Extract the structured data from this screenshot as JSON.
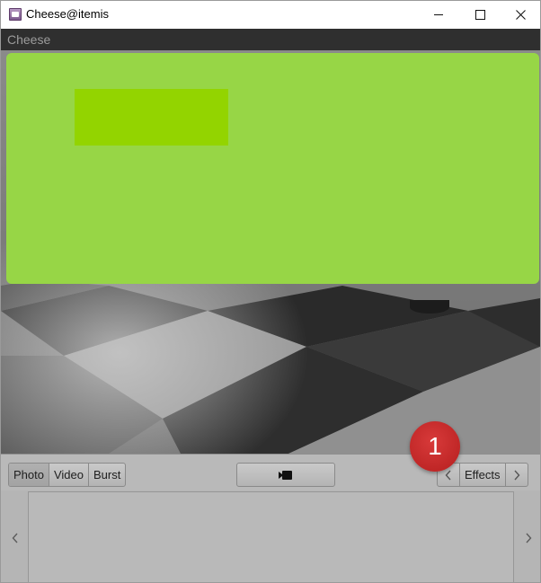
{
  "window": {
    "title": "Cheese@itemis",
    "icon": "cheese-app-icon",
    "controls": [
      "minimize-icon",
      "maximize-icon",
      "close-icon"
    ]
  },
  "header": {
    "title": "Cheese"
  },
  "modes": {
    "items": [
      {
        "label": "Photo",
        "active": true
      },
      {
        "label": "Video",
        "active": false
      },
      {
        "label": "Burst",
        "active": false
      }
    ]
  },
  "capture": {
    "icon": "camera-icon"
  },
  "effects": {
    "label": "Effects",
    "prev_icon": "chevron-left-icon",
    "next_icon": "chevron-right-icon"
  },
  "annotation": {
    "number": "1",
    "color": "#c62828"
  },
  "overlay": {
    "color": "#97d646",
    "inner_color": "#93d400"
  },
  "thumbnails": {
    "prev_icon": "chevron-left-icon",
    "next_icon": "chevron-right-icon",
    "items": []
  }
}
